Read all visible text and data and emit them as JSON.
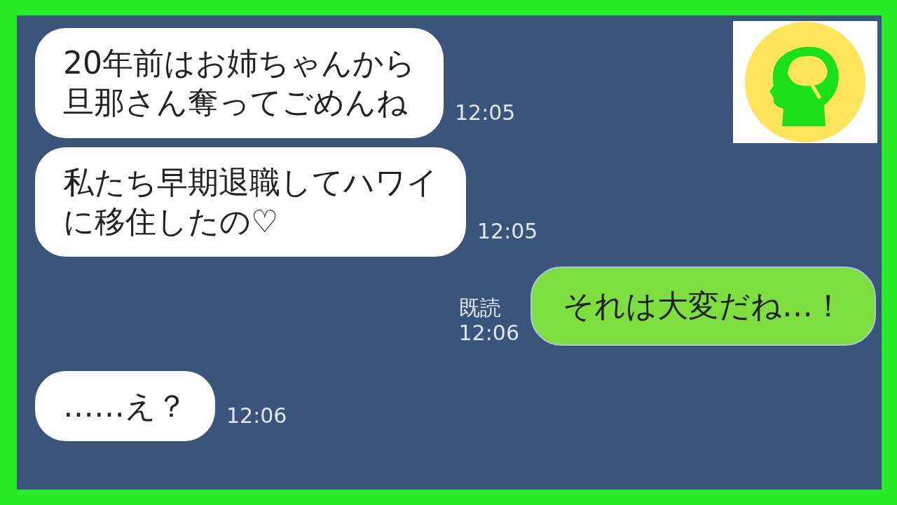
{
  "messages": [
    {
      "kind": "received",
      "lines": [
        "20年前はお姉ちゃんから",
        "旦那さん奪ってごめんね"
      ],
      "time": "12:05"
    },
    {
      "kind": "received",
      "lines": [
        "私たち早期退職してハワイ",
        "に移住したの♡"
      ],
      "time": "12:05"
    },
    {
      "kind": "sent",
      "lines": [
        "それは大変だね…！"
      ],
      "read": "既読",
      "time": "12:06"
    },
    {
      "kind": "received",
      "lines": [
        "……え？"
      ],
      "time": "12:06"
    }
  ]
}
